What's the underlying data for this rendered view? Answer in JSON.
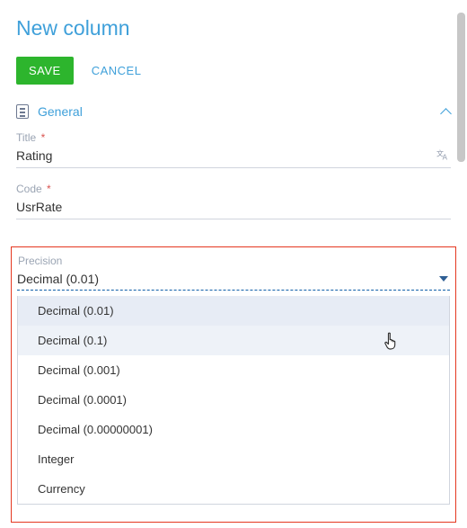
{
  "page_title": "New column",
  "buttons": {
    "save": "SAVE",
    "cancel": "CANCEL"
  },
  "section": {
    "title": "General"
  },
  "fields": {
    "title": {
      "label": "Title",
      "value": "Rating"
    },
    "code": {
      "label": "Code",
      "value": "UsrRate"
    },
    "precision": {
      "label": "Precision",
      "value": "Decimal (0.01)"
    }
  },
  "dropdown": {
    "options": [
      "Decimal (0.01)",
      "Decimal (0.1)",
      "Decimal (0.001)",
      "Decimal (0.0001)",
      "Decimal (0.00000001)",
      "Integer",
      "Currency"
    ],
    "selected_index": 0,
    "hover_index": 1
  }
}
